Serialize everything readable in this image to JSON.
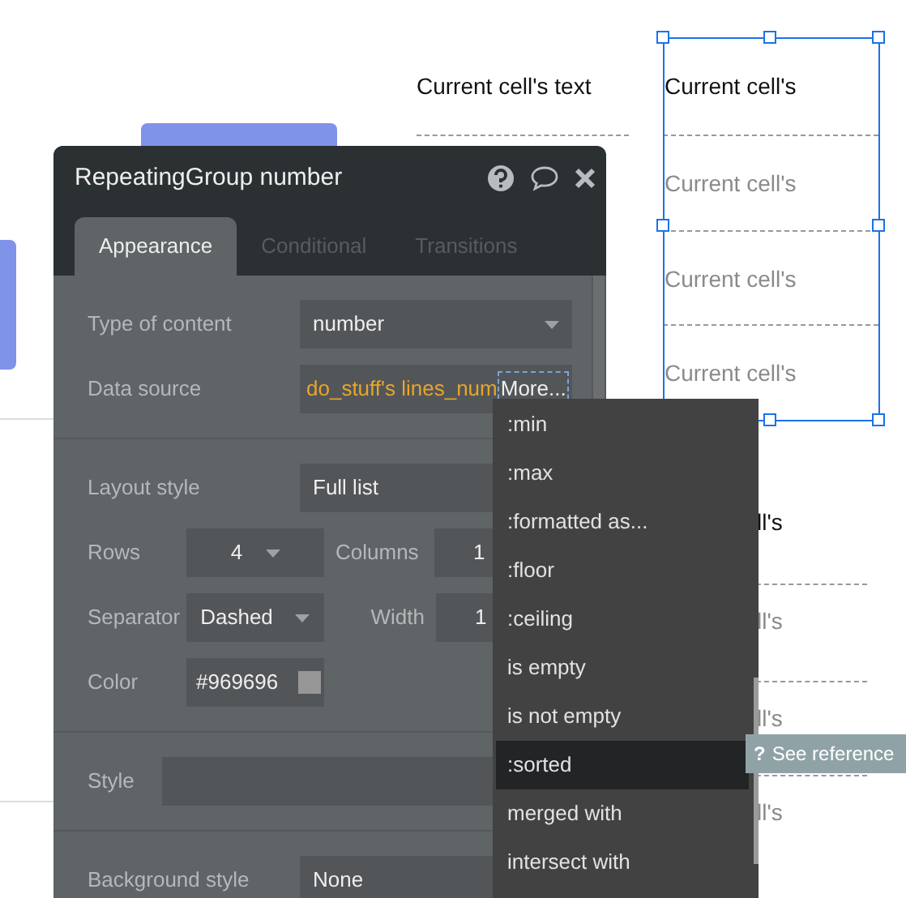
{
  "canvas": {
    "header_text": "Current cell's text",
    "selected_group": {
      "selected": true,
      "cells": [
        {
          "text": "Current cell's",
          "dimmed": false
        },
        {
          "text": "Current cell's",
          "dimmed": true
        },
        {
          "text": "Current cell's",
          "dimmed": true
        },
        {
          "text": "Current cell's",
          "dimmed": true
        }
      ]
    },
    "lower_group": {
      "cells": [
        {
          "text": "ll's",
          "dimmed": false
        },
        {
          "text": "ll's",
          "dimmed": true
        },
        {
          "text": "ll's",
          "dimmed": true
        },
        {
          "text": "ll's",
          "dimmed": true
        }
      ]
    }
  },
  "panel": {
    "title": "RepeatingGroup number",
    "tabs": [
      {
        "label": "Appearance",
        "selected": true
      },
      {
        "label": "Conditional",
        "selected": false
      },
      {
        "label": "Transitions",
        "selected": false
      }
    ],
    "sections": [
      {
        "rows": [
          {
            "label": "Type of content",
            "controls": [
              {
                "kind": "dropdown",
                "value": "number"
              }
            ]
          },
          {
            "label": "Data source",
            "controls": [
              {
                "kind": "expression",
                "value": "do_stuff's lines_num",
                "more": "More..."
              }
            ]
          }
        ]
      },
      {
        "rows": [
          {
            "label": "Layout style",
            "controls": [
              {
                "kind": "field",
                "value": "Full list"
              }
            ]
          },
          {
            "label": "Rows",
            "controls": [
              {
                "kind": "dropdown",
                "value": "4"
              },
              {
                "kind": "label",
                "text": "Columns"
              },
              {
                "kind": "field",
                "value": "1"
              }
            ]
          },
          {
            "label": "Separator",
            "controls": [
              {
                "kind": "dropdown",
                "value": "Dashed"
              },
              {
                "kind": "label",
                "text": "Width"
              },
              {
                "kind": "field",
                "value": "1"
              }
            ]
          },
          {
            "label": "Color",
            "controls": [
              {
                "kind": "color",
                "value": "#969696",
                "color": "#969696"
              }
            ]
          }
        ]
      },
      {
        "rows": [
          {
            "label": "Style",
            "controls": [
              {
                "kind": "field"
              }
            ]
          }
        ]
      },
      {
        "rows": [
          {
            "label": "Background style",
            "controls": [
              {
                "kind": "field",
                "value": "None"
              }
            ]
          }
        ]
      }
    ]
  },
  "menu": {
    "items": [
      {
        "label": ":min",
        "selected": false
      },
      {
        "label": ":max",
        "selected": false
      },
      {
        "label": ":formatted as...",
        "selected": false
      },
      {
        "label": ":floor",
        "selected": false
      },
      {
        "label": ":ceiling",
        "selected": false
      },
      {
        "label": "is empty",
        "selected": false
      },
      {
        "label": "is not empty",
        "selected": false
      },
      {
        "label": ":sorted",
        "selected": true
      },
      {
        "label": "merged with",
        "selected": false
      },
      {
        "label": "intersect with",
        "selected": false
      }
    ],
    "tooltip": {
      "icon": "?",
      "text": "See reference"
    }
  }
}
